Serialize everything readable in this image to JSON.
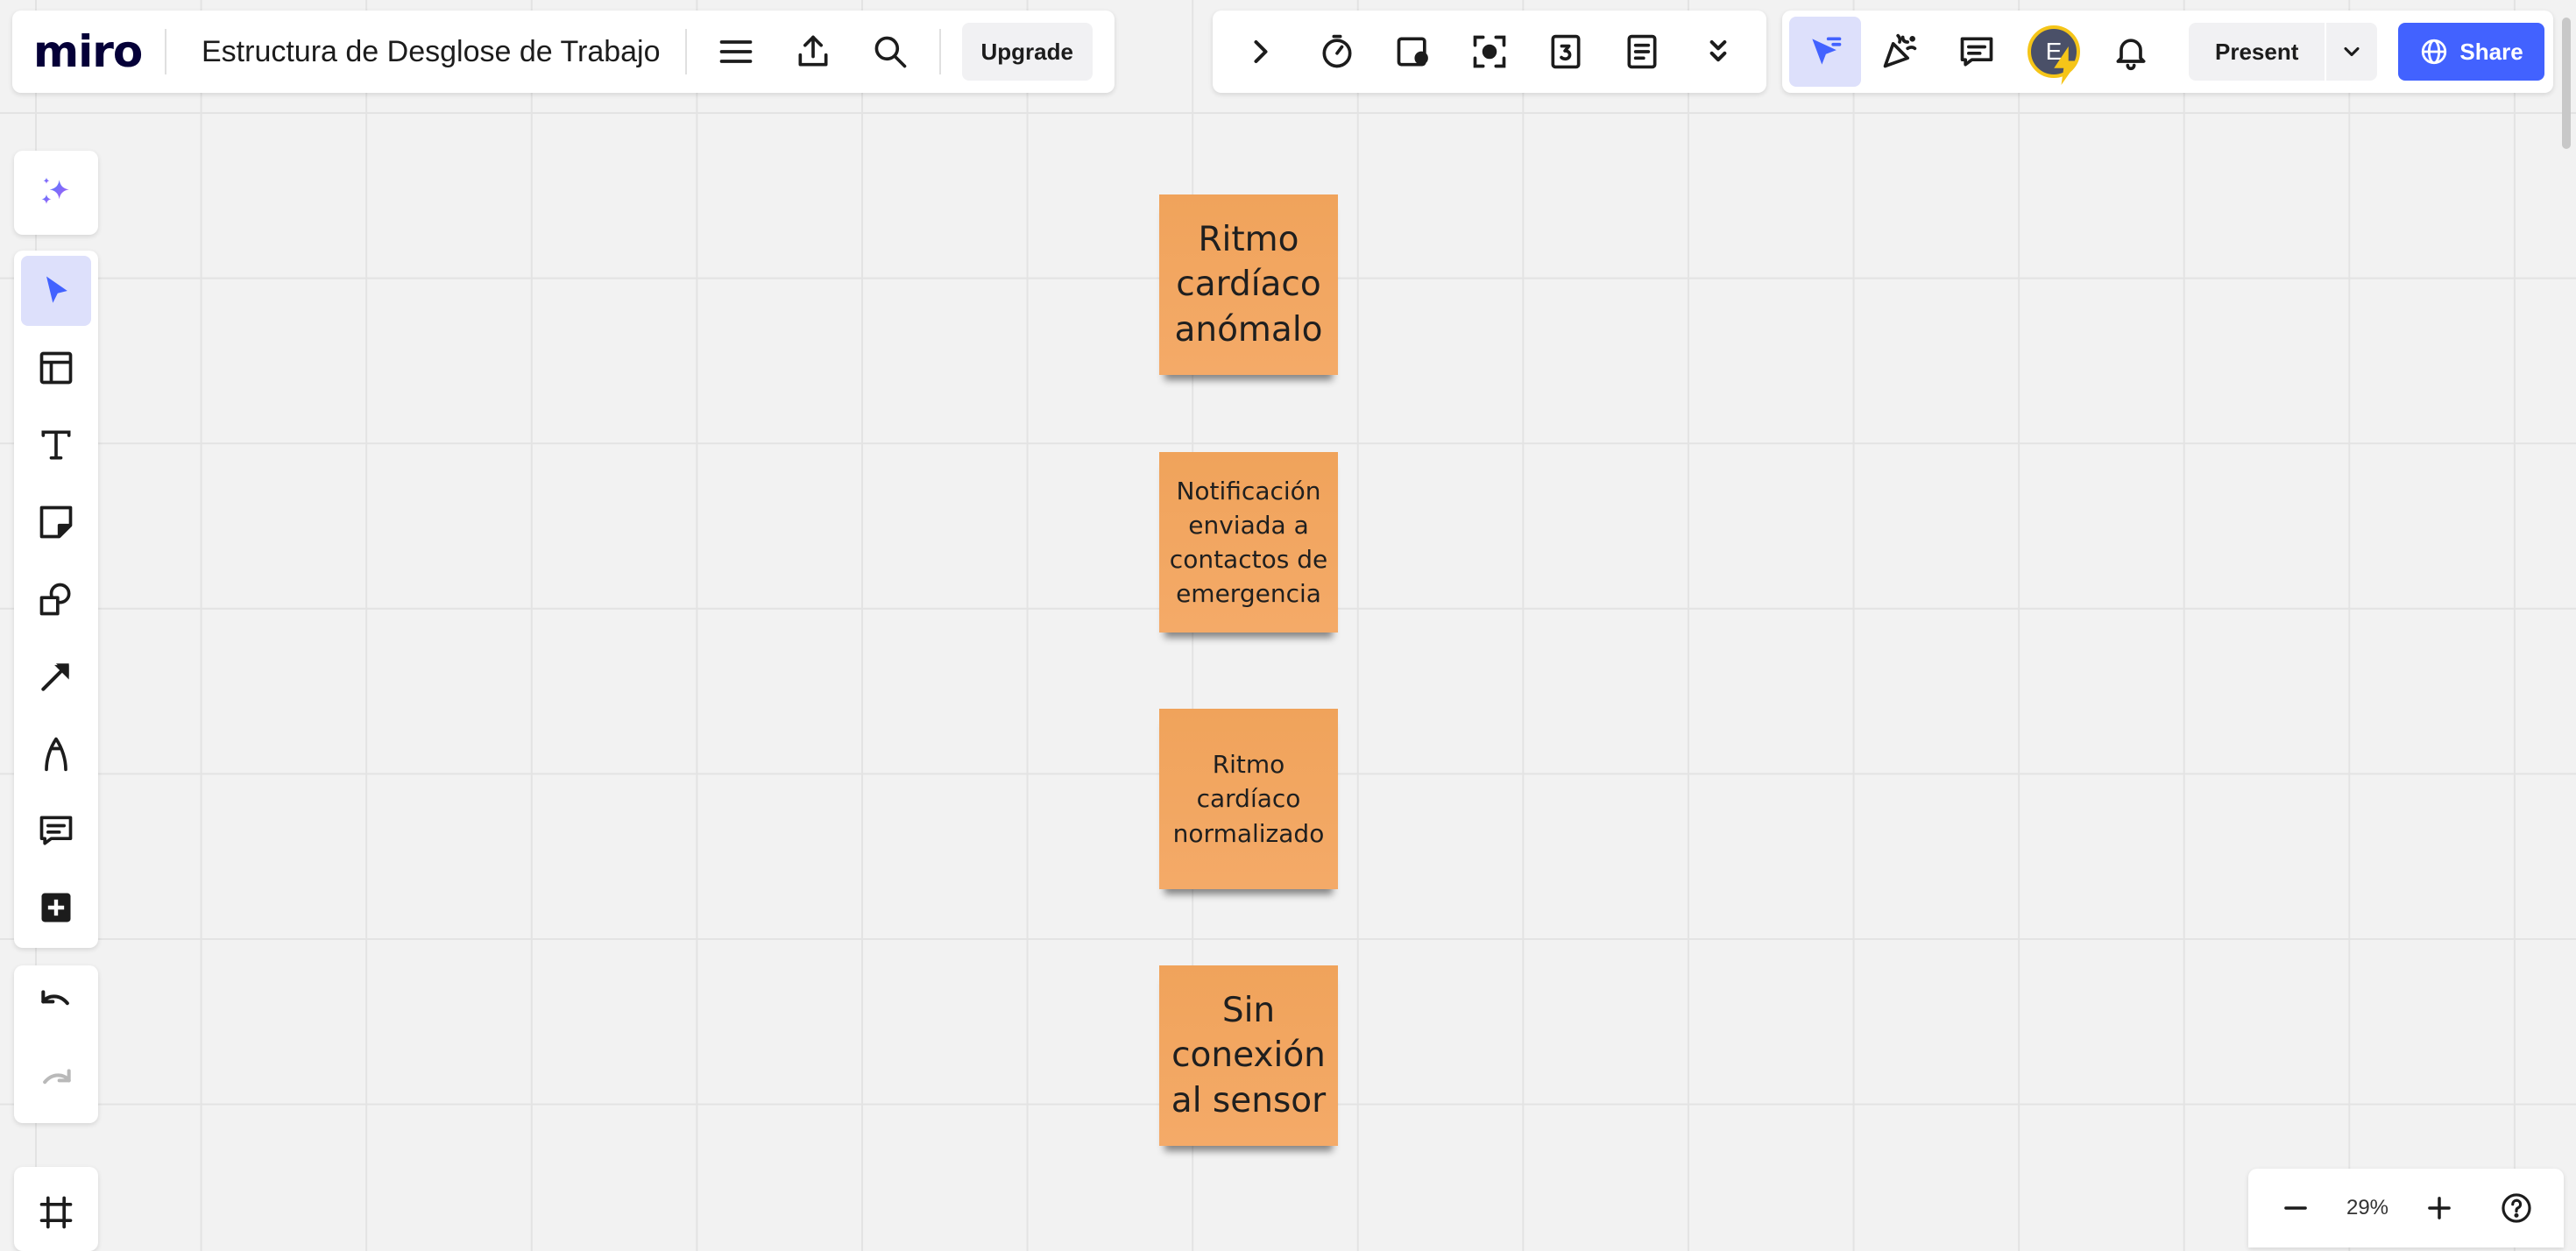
{
  "app": {
    "logo": "miro"
  },
  "board": {
    "title": "Estructura de Desglose de Trabajo"
  },
  "toolbar_left": {
    "upgrade_label": "Upgrade",
    "icons": [
      "menu-icon",
      "export-icon",
      "search-icon"
    ]
  },
  "toolbar_center": {
    "icons": [
      "chevron-right-icon",
      "timer-icon",
      "card-icon",
      "focus-icon",
      "counter-icon",
      "notes-icon",
      "chevrons-down-icon"
    ]
  },
  "toolbar_right": {
    "avatar_initial": "E",
    "present_label": "Present",
    "share_label": "Share",
    "icons": [
      "cursor-follow-icon",
      "celebrate-icon",
      "comments-icon",
      "bell-icon"
    ]
  },
  "left_toolbar": {
    "tools": [
      "select",
      "templates",
      "text",
      "sticky-note",
      "shapes",
      "arrow",
      "pen",
      "comment",
      "add"
    ]
  },
  "stickies": [
    {
      "text": "Ritmo cardíaco anómalo"
    },
    {
      "text": "Notificación enviada a contactos de emergencia"
    },
    {
      "text": "Ritmo cardíaco normalizado"
    },
    {
      "text": "Sin conexión al sensor"
    }
  ],
  "zoom": {
    "value": "29%"
  },
  "colors": {
    "accent": "#4262ff",
    "sticky": "#f2a660",
    "active_tool_bg": "#dde0fb"
  }
}
